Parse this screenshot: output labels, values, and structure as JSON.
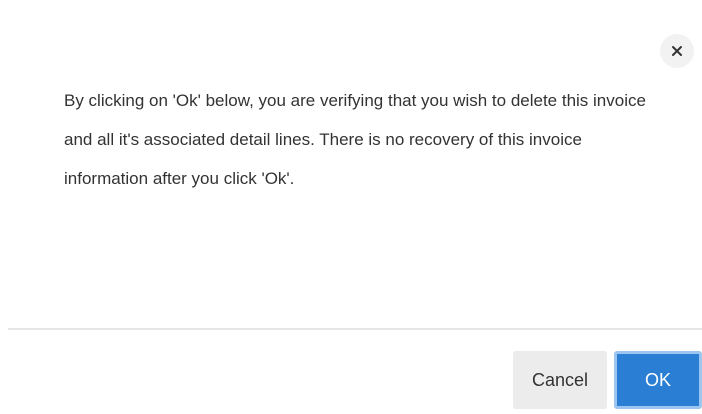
{
  "dialog": {
    "close_icon": "close-icon",
    "message": "By clicking on 'Ok' below, you are verifying that you wish to delete this invoice and all it's associated detail lines. There is no recovery of this invoice information after you click 'Ok'.",
    "cancel_label": "Cancel",
    "ok_label": "OK"
  },
  "colors": {
    "primary": "#2a7fd4",
    "secondary_bg": "#ececec",
    "text": "#333333"
  }
}
